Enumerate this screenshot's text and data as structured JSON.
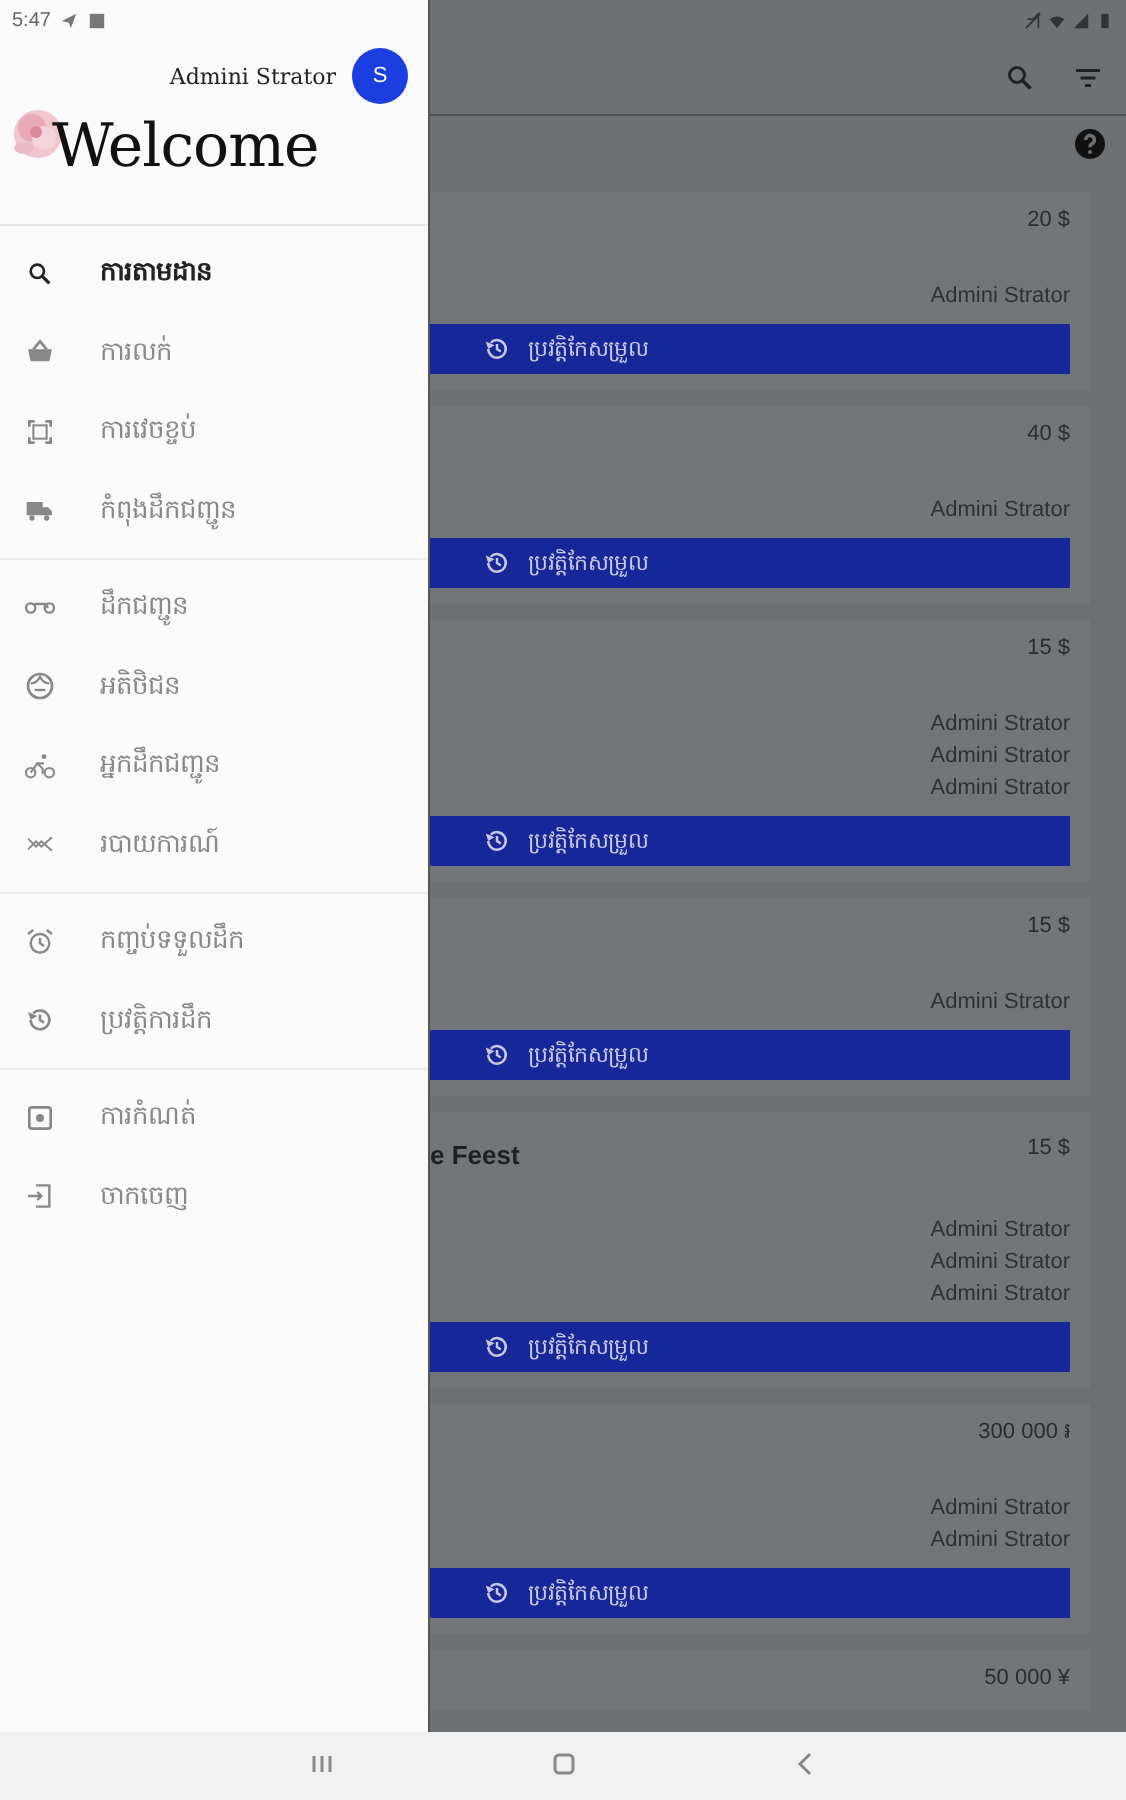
{
  "status_bar": {
    "time": "5:47"
  },
  "drawer": {
    "user_name": "Admini Strator",
    "avatar_letter": "S",
    "welcome": "Welcome",
    "groups": [
      {
        "items": [
          {
            "label": "ការតាមដាន",
            "selected": true
          },
          {
            "label": "ការលក់",
            "selected": false
          },
          {
            "label": "ការវេចខ្ចប់",
            "selected": false
          },
          {
            "label": "កំពុងដឹកជញ្ជូន",
            "selected": false
          }
        ]
      },
      {
        "items": [
          {
            "label": "ដឹកជញ្ជូន",
            "selected": false
          },
          {
            "label": "អតិថិជន",
            "selected": false
          },
          {
            "label": "អ្នកដឹកជញ្ជូន",
            "selected": false
          },
          {
            "label": "របាយការណ៍",
            "selected": false
          }
        ]
      },
      {
        "items": [
          {
            "label": "កញ្ចប់ទទួលដឹក",
            "selected": false
          },
          {
            "label": "ប្រវត្តិការដឹក",
            "selected": false
          }
        ]
      },
      {
        "items": [
          {
            "label": "ការកំណត់",
            "selected": false
          },
          {
            "label": "ចាកចេញ",
            "selected": false
          }
        ]
      }
    ]
  },
  "cards": [
    {
      "price": "20 $",
      "names": [
        "Admini Strator"
      ],
      "button": "ប្រវត្តិកែសម្រួល"
    },
    {
      "price": "40 $",
      "names": [
        "Admini Strator"
      ],
      "button": "ប្រវត្តិកែសម្រួល"
    },
    {
      "price": "15 $",
      "names": [
        "Admini Strator",
        "Admini Strator",
        "Admini Strator"
      ],
      "button": "ប្រវត្តិកែសម្រួល"
    },
    {
      "price": "15 $",
      "names": [
        "Admini Strator"
      ],
      "button": "ប្រវត្តិកែសម្រួល"
    },
    {
      "title": "e Feest",
      "price": "15 $",
      "names": [
        "Admini Strator",
        "Admini Strator",
        "Admini Strator"
      ],
      "button": "ប្រវត្តិកែសម្រួល"
    },
    {
      "price": "300 000 ៛",
      "names": [
        "Admini Strator",
        "Admini Strator"
      ],
      "button": "ប្រវត្តិកែសម្រួល"
    },
    {
      "price": "50 000 ¥"
    }
  ]
}
